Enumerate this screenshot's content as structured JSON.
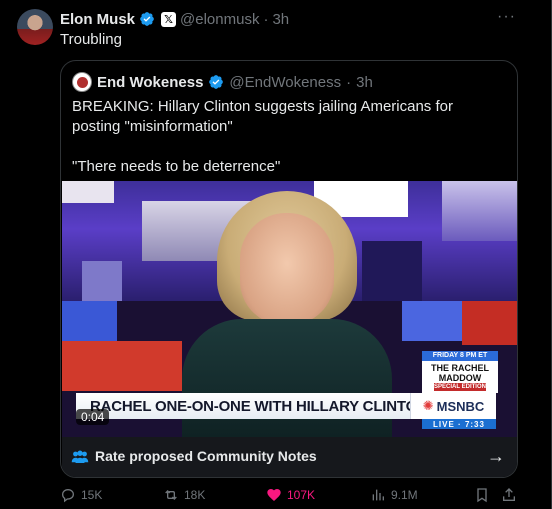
{
  "author": {
    "name": "Elon Musk",
    "handle": "@elonmusk",
    "time": "3h",
    "separator": "·"
  },
  "tweet_text": "Troubling",
  "quoted": {
    "name": "End Wokeness",
    "handle": "@EndWokeness",
    "time": "3h",
    "separator": "·",
    "text_line1": "BREAKING: Hillary Clinton suggests jailing Americans for posting \"misinformation\"",
    "text_line2": "\"There needs to be deterrence\""
  },
  "video": {
    "chyron": "RACHEL ONE-ON-ONE WITH HILLARY CLINTON",
    "network": "MSNBC",
    "live_label": "LIVE · 7:33",
    "promo_top": "FRIDAY 8 PM ET",
    "promo_title": "THE RACHEL MADDOW",
    "promo_sub": "SPECIAL EDITION",
    "timestamp": "0:04"
  },
  "community_notes": {
    "label": "Rate proposed Community Notes"
  },
  "actions": {
    "replies": "15K",
    "reposts": "18K",
    "likes": "107K",
    "views": "9.1M"
  },
  "colors": {
    "background": "#000000",
    "text": "#e7e9ea",
    "muted": "#71767b",
    "verified": "#1d9bf0",
    "like": "#f91880",
    "border": "#2f3336"
  }
}
